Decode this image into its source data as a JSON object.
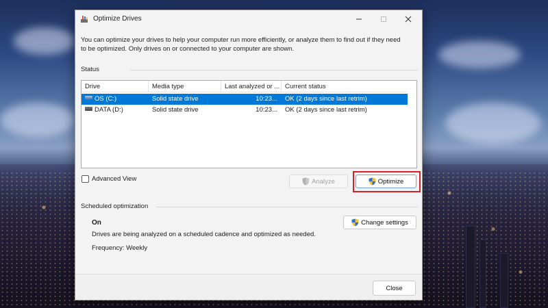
{
  "window": {
    "title": "Optimize Drives",
    "description": "You can optimize your drives to help your computer run more efficiently, or analyze them to find out if they need to be optimized. Only drives on or connected to your computer are shown."
  },
  "status": {
    "label": "Status",
    "columns": [
      "Drive",
      "Media type",
      "Last analyzed or ...",
      "Current status"
    ],
    "drives": [
      {
        "drive": "OS (C:)",
        "media": "Solid state drive",
        "last": "10:23...",
        "status": "OK (2 days since last retrim)",
        "selected": true
      },
      {
        "drive": "DATA (D:)",
        "media": "Solid state drive",
        "last": "10:23...",
        "status": "OK (2 days since last retrim)",
        "selected": false
      }
    ]
  },
  "controls": {
    "advanced_view": "Advanced View",
    "analyze": "Analyze",
    "optimize": "Optimize"
  },
  "schedule": {
    "label": "Scheduled optimization",
    "state": "On",
    "description": "Drives are being analyzed on a scheduled cadence and optimized as needed.",
    "frequency": "Frequency: Weekly",
    "change_settings": "Change settings"
  },
  "footer": {
    "close": "Close"
  },
  "colors": {
    "selection": "#0078d7",
    "highlight_border": "#d42027"
  }
}
